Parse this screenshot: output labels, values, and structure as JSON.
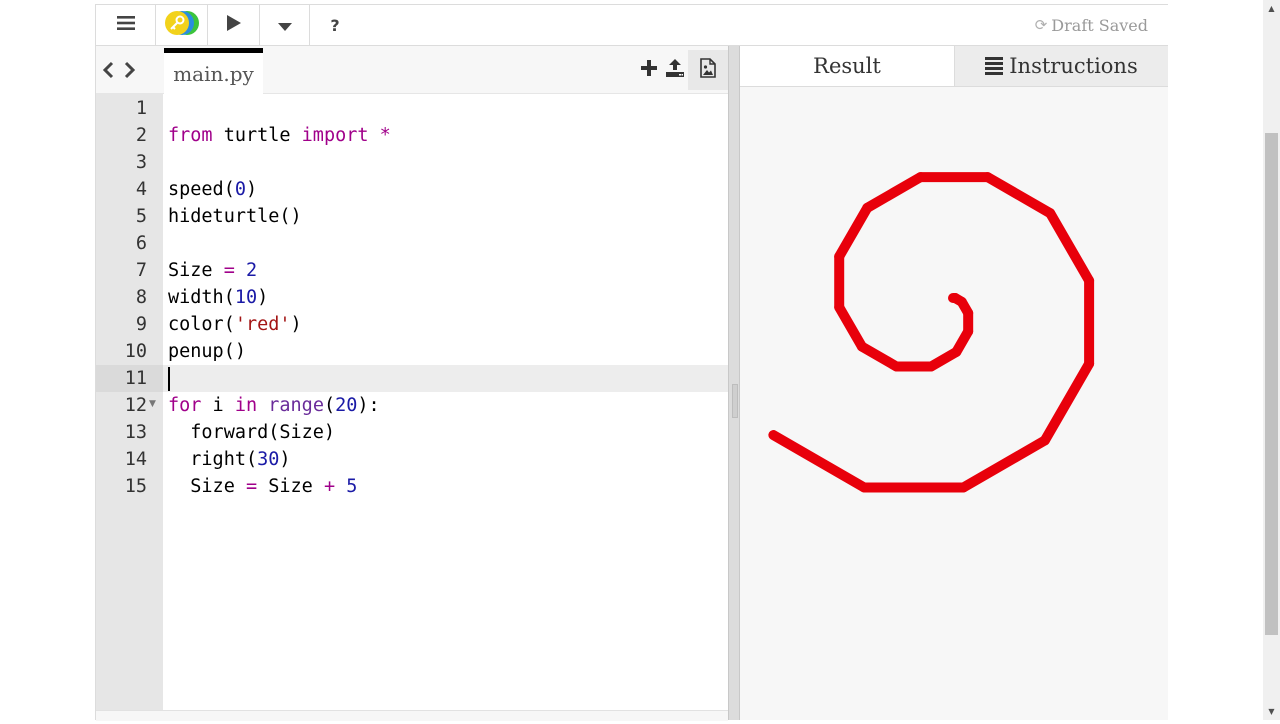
{
  "toolbar": {
    "menu_icon": "hamburger-icon",
    "logo_icon": "trinket-key-logo",
    "run_icon": "play-icon",
    "dropdown_icon": "caret-down-icon",
    "help_label": "?",
    "status_icon": "refresh-icon",
    "status_text": "Draft Saved"
  },
  "editor": {
    "nav_back": "‹",
    "nav_forward": "›",
    "active_file": "main.py",
    "actions": [
      {
        "name": "add-file",
        "icon": "plus-icon"
      },
      {
        "name": "upload",
        "icon": "upload-icon"
      },
      {
        "name": "images",
        "icon": "image-file-icon"
      }
    ],
    "active_line": 11,
    "lines": [
      {
        "n": "1",
        "tokens": []
      },
      {
        "n": "2",
        "tokens": [
          {
            "t": "kw",
            "v": "from"
          },
          {
            "t": "",
            "v": " turtle "
          },
          {
            "t": "kw",
            "v": "import"
          },
          {
            "t": "",
            "v": " "
          },
          {
            "t": "op",
            "v": "*"
          }
        ]
      },
      {
        "n": "3",
        "tokens": []
      },
      {
        "n": "4",
        "tokens": [
          {
            "t": "",
            "v": "speed("
          },
          {
            "t": "num",
            "v": "0"
          },
          {
            "t": "",
            "v": ")"
          }
        ]
      },
      {
        "n": "5",
        "tokens": [
          {
            "t": "",
            "v": "hideturtle()"
          }
        ]
      },
      {
        "n": "6",
        "tokens": []
      },
      {
        "n": "7",
        "tokens": [
          {
            "t": "",
            "v": "Size "
          },
          {
            "t": "op",
            "v": "="
          },
          {
            "t": "",
            "v": " "
          },
          {
            "t": "num",
            "v": "2"
          }
        ]
      },
      {
        "n": "8",
        "tokens": [
          {
            "t": "",
            "v": "width("
          },
          {
            "t": "num",
            "v": "10"
          },
          {
            "t": "",
            "v": ")"
          }
        ]
      },
      {
        "n": "9",
        "tokens": [
          {
            "t": "",
            "v": "color("
          },
          {
            "t": "str",
            "v": "'red'"
          },
          {
            "t": "",
            "v": ")"
          }
        ]
      },
      {
        "n": "10",
        "tokens": [
          {
            "t": "",
            "v": "penup()"
          }
        ]
      },
      {
        "n": "11",
        "tokens": []
      },
      {
        "n": "12",
        "fold": true,
        "tokens": [
          {
            "t": "kw",
            "v": "for"
          },
          {
            "t": "",
            "v": " i "
          },
          {
            "t": "kw",
            "v": "in"
          },
          {
            "t": "",
            "v": " "
          },
          {
            "t": "bi",
            "v": "range"
          },
          {
            "t": "",
            "v": "("
          },
          {
            "t": "num",
            "v": "20"
          },
          {
            "t": "",
            "v": "):"
          }
        ]
      },
      {
        "n": "13",
        "tokens": [
          {
            "t": "",
            "v": "  forward(Size)"
          }
        ]
      },
      {
        "n": "14",
        "tokens": [
          {
            "t": "",
            "v": "  right("
          },
          {
            "t": "num",
            "v": "30"
          },
          {
            "t": "",
            "v": ")"
          }
        ]
      },
      {
        "n": "15",
        "tokens": [
          {
            "t": "",
            "v": "  Size "
          },
          {
            "t": "op",
            "v": "="
          },
          {
            "t": "",
            "v": " Size "
          },
          {
            "t": "op",
            "v": "+"
          },
          {
            "t": "",
            "v": " "
          },
          {
            "t": "num",
            "v": "5"
          }
        ]
      }
    ]
  },
  "result": {
    "tabs": [
      {
        "label": "Result",
        "active": true
      },
      {
        "label": "Instructions",
        "active": false,
        "icon": "list-icon"
      }
    ],
    "drawing": {
      "type": "turtle-spiral",
      "pen_color": "#e8000b",
      "pen_width": 10,
      "start_size": 2,
      "increment": 5,
      "turn_right_degrees": 30,
      "iterations": 20
    }
  },
  "colors": {
    "keyword": "#a0008a",
    "number": "#1a1aa6",
    "string": "#a31515",
    "pen": "#e8000b"
  }
}
